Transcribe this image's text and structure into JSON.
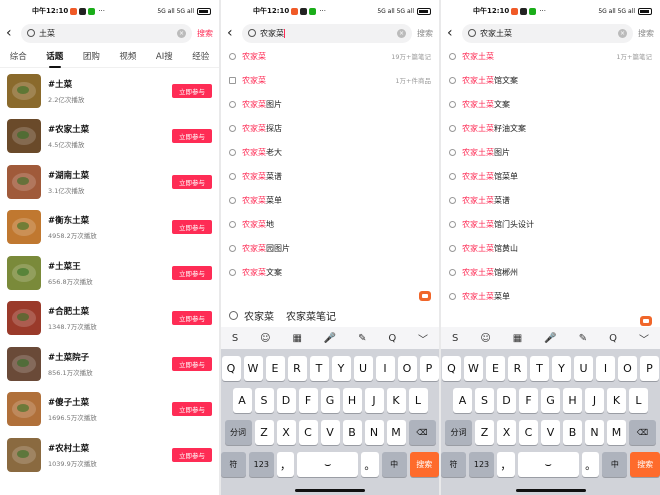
{
  "status": {
    "time": "中午12:10",
    "dots": "···",
    "net": "5G all 5G all",
    "battery": "98"
  },
  "screen1": {
    "back": "‹",
    "query": "土菜",
    "search_btn": "搜索",
    "tabs": [
      "综合",
      "话题",
      "团购",
      "视频",
      "AI搜",
      "经验"
    ],
    "active_tab": 1,
    "join_label": "立即参与",
    "topics": [
      {
        "name": "#土菜",
        "plays": "2.2亿次播放",
        "color": "#8a6a2c"
      },
      {
        "name": "#农家土菜",
        "plays": "4.5亿次播放",
        "color": "#6a4a2a"
      },
      {
        "name": "#湖南土菜",
        "plays": "3.1亿次播放",
        "color": "#a05a3a"
      },
      {
        "name": "#衡东土菜",
        "plays": "4958.2万次播放",
        "color": "#c07830"
      },
      {
        "name": "#土菜王",
        "plays": "656.8万次播放",
        "color": "#7a8a3a"
      },
      {
        "name": "#合肥土菜",
        "plays": "1348.7万次播放",
        "color": "#9a3a2a"
      },
      {
        "name": "#土菜院子",
        "plays": "856.1万次播放",
        "color": "#6a4a38"
      },
      {
        "name": "#傻子土菜",
        "plays": "1696.5万次播放",
        "color": "#b0703a"
      },
      {
        "name": "#农村土菜",
        "plays": "1039.9万次播放",
        "color": "#8a6a40"
      }
    ]
  },
  "screen2": {
    "query": "农家菜",
    "search_btn": "搜索",
    "suggestions": [
      {
        "hl": "农家菜",
        "rest": "",
        "meta": "19万+篇笔记",
        "icon": "search"
      },
      {
        "hl": "农家菜",
        "rest": "",
        "meta": "1万+件商品",
        "icon": "doc"
      },
      {
        "hl": "农家菜",
        "rest": "图片",
        "meta": "",
        "icon": "search"
      },
      {
        "hl": "农家菜",
        "rest": "探店",
        "meta": "",
        "icon": "search"
      },
      {
        "hl": "农家菜",
        "rest": "老大",
        "meta": "",
        "icon": "search"
      },
      {
        "hl": "农家菜",
        "rest": "菜谱",
        "meta": "",
        "icon": "search"
      },
      {
        "hl": "农家菜",
        "rest": "菜单",
        "meta": "",
        "icon": "search"
      },
      {
        "hl": "农家菜",
        "rest": "地",
        "meta": "",
        "icon": "search"
      },
      {
        "hl": "农家菜",
        "rest": "园图片",
        "meta": "",
        "icon": "search"
      },
      {
        "hl": "农家菜",
        "rest": "文案",
        "meta": "",
        "icon": "search"
      }
    ],
    "candidates": [
      "农家菜",
      "农家菜笔记"
    ]
  },
  "screen3": {
    "query": "农家土菜",
    "search_btn": "搜索",
    "suggestions": [
      {
        "hl": "农家土菜",
        "rest": "",
        "meta": "1万+篇笔记"
      },
      {
        "hl": "农家土菜",
        "rest": "馆文案",
        "meta": ""
      },
      {
        "hl": "农家土菜",
        "rest": "文案",
        "meta": ""
      },
      {
        "hl": "农家土菜",
        "rest": "籽油文案",
        "meta": ""
      },
      {
        "hl": "农家土菜",
        "rest": "图片",
        "meta": ""
      },
      {
        "hl": "农家土菜",
        "rest": "馆菜单",
        "meta": ""
      },
      {
        "hl": "农家土菜",
        "rest": "菜谱",
        "meta": ""
      },
      {
        "hl": "农家土菜",
        "rest": "馆门头设计",
        "meta": ""
      },
      {
        "hl": "农家土菜",
        "rest": "馆黄山",
        "meta": ""
      },
      {
        "hl": "农家土菜",
        "rest": "馆郴州",
        "meta": ""
      },
      {
        "hl": "农家土菜",
        "rest": "菜单",
        "meta": ""
      }
    ]
  },
  "keyboard": {
    "toolbar": [
      "S",
      "☺",
      "▦",
      "🎤",
      "✎",
      "Q",
      "﹀"
    ],
    "row1": [
      "Q",
      "W",
      "E",
      "R",
      "T",
      "Y",
      "U",
      "I",
      "O",
      "P"
    ],
    "row2": [
      "A",
      "S",
      "D",
      "F",
      "G",
      "H",
      "J",
      "K",
      "L"
    ],
    "row3": [
      "Z",
      "X",
      "C",
      "V",
      "B",
      "N",
      "M"
    ],
    "fn_fenci": "分词",
    "fn_fu": "符",
    "fn_123": "123",
    "comma": "，",
    "period": "。",
    "zh": "中",
    "go": "搜索"
  }
}
